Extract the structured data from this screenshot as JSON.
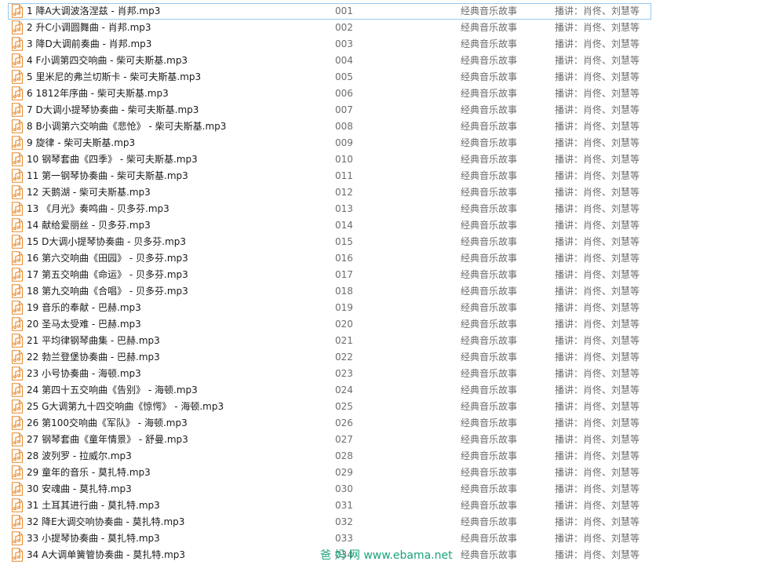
{
  "files": [
    {
      "name": "1 降A大调波洛涅兹 - 肖邦.mp3",
      "track": "001"
    },
    {
      "name": "2 升C小调圆舞曲 - 肖邦.mp3",
      "track": "002"
    },
    {
      "name": "3 降D大调前奏曲 - 肖邦.mp3",
      "track": "003"
    },
    {
      "name": "4 F小调第四交响曲 - 柴可夫斯基.mp3",
      "track": "004"
    },
    {
      "name": "5 里米尼的弗兰切斯卡 - 柴可夫斯基.mp3",
      "track": "005"
    },
    {
      "name": "6 1812年序曲 - 柴可夫斯基.mp3",
      "track": "006"
    },
    {
      "name": "7 D大调小提琴协奏曲 - 柴可夫斯基.mp3",
      "track": "007"
    },
    {
      "name": "8 B小调第六交响曲《悲怆》 - 柴可夫斯基.mp3",
      "track": "008"
    },
    {
      "name": "9 旋律 - 柴可夫斯基.mp3",
      "track": "009"
    },
    {
      "name": "10 钢琴套曲《四季》 - 柴可夫斯基.mp3",
      "track": "010"
    },
    {
      "name": "11 第一钢琴协奏曲 - 柴可夫斯基.mp3",
      "track": "011"
    },
    {
      "name": "12 天鹅湖 - 柴可夫斯基.mp3",
      "track": "012"
    },
    {
      "name": "13 《月光》奏鸣曲 - 贝多芬.mp3",
      "track": "013"
    },
    {
      "name": "14 献给爱丽丝 - 贝多芬.mp3",
      "track": "014"
    },
    {
      "name": "15 D大调小提琴协奏曲 - 贝多芬.mp3",
      "track": "015"
    },
    {
      "name": "16 第六交响曲《田园》 - 贝多芬.mp3",
      "track": "016"
    },
    {
      "name": "17 第五交响曲《命运》 - 贝多芬.mp3",
      "track": "017"
    },
    {
      "name": "18 第九交响曲《合唱》 - 贝多芬.mp3",
      "track": "018"
    },
    {
      "name": "19 音乐的奉献 - 巴赫.mp3",
      "track": "019"
    },
    {
      "name": "20 圣马太受难 - 巴赫.mp3",
      "track": "020"
    },
    {
      "name": "21 平均律钢琴曲集 - 巴赫.mp3",
      "track": "021"
    },
    {
      "name": "22 勃兰登堡协奏曲 - 巴赫.mp3",
      "track": "022"
    },
    {
      "name": "23 小号协奏曲 - 海顿.mp3",
      "track": "023"
    },
    {
      "name": "24 第四十五交响曲《告别》 - 海顿.mp3",
      "track": "024"
    },
    {
      "name": "25 G大调第九十四交响曲《惊愕》 - 海顿.mp3",
      "track": "025"
    },
    {
      "name": "26 第100交响曲《军队》 - 海顿.mp3",
      "track": "026"
    },
    {
      "name": "27 钢琴套曲《童年情景》 - 舒曼.mp3",
      "track": "027"
    },
    {
      "name": "28 波列罗 - 拉威尔.mp3",
      "track": "028"
    },
    {
      "name": "29 童年的音乐 - 莫扎特.mp3",
      "track": "029"
    },
    {
      "name": "30 安魂曲 - 莫扎特.mp3",
      "track": "030"
    },
    {
      "name": "31 土耳其进行曲 - 莫扎特.mp3",
      "track": "031"
    },
    {
      "name": "32 降E大调交响协奏曲 - 莫扎特.mp3",
      "track": "032"
    },
    {
      "name": "33 小提琴协奏曲 - 莫扎特.mp3",
      "track": "033"
    },
    {
      "name": "34 A大调单簧管协奏曲 - 莫扎特.mp3",
      "track": "034"
    }
  ],
  "shared": {
    "album": "经典音乐故事",
    "artist": "播讲：肖佟、刘慧等"
  },
  "selected_index": 0,
  "watermark": "爸 妈 网  www.ebama.net",
  "icon": "music-file-icon",
  "colors": {
    "icon_orange": "#e8892b",
    "selection_border": "#99c9ef",
    "watermark_green": "#1aa37a",
    "secondary_text": "#6d6d6d"
  }
}
